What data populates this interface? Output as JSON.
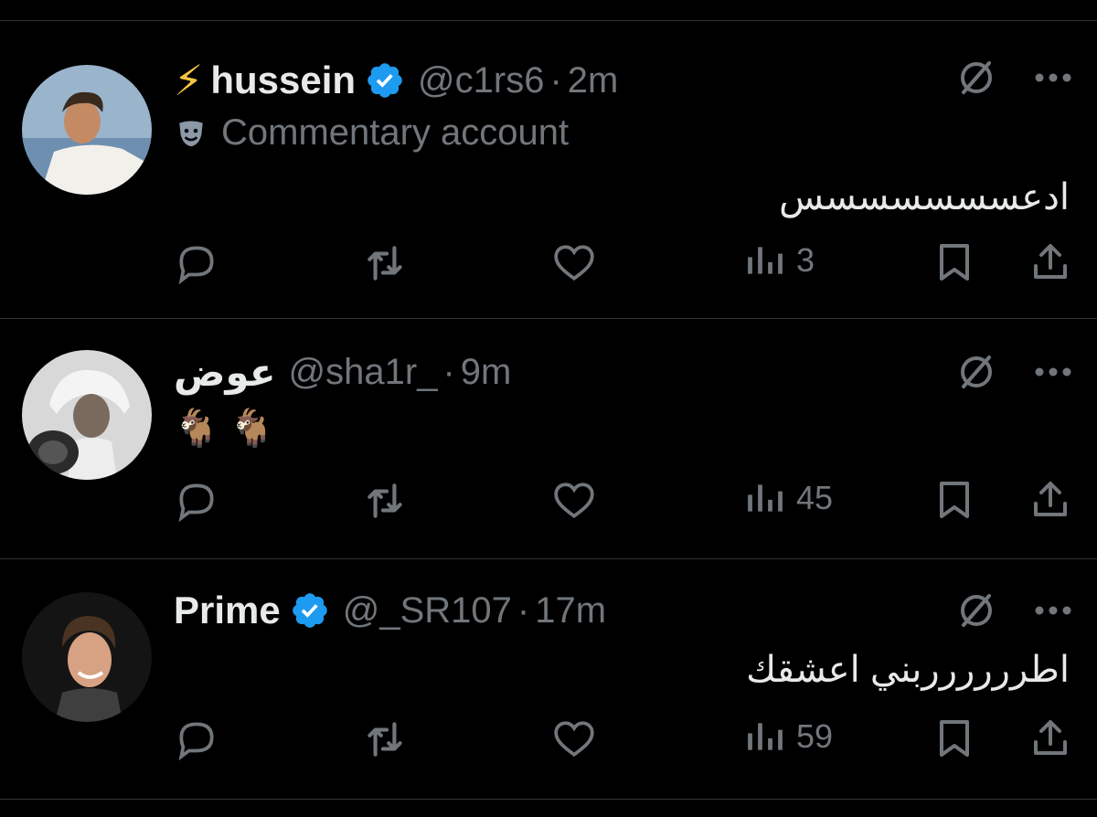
{
  "tweets": [
    {
      "name": "hussein",
      "name_prefix": "⚡",
      "verified": true,
      "handle": "@c1rs6",
      "time": "2m",
      "label": "Commentary account",
      "label_icon": "theater-masks-icon",
      "text": "ادعسسسسسسس",
      "views": "3"
    },
    {
      "name": "عوض",
      "verified": false,
      "handle": "@sha1r_",
      "time": "9m",
      "text": "🐐 🐐",
      "views": "45"
    },
    {
      "name": "Prime",
      "verified": true,
      "handle": "@_SR107",
      "time": "17m",
      "text": "اطرررررربني اعشقك",
      "views": "59"
    }
  ],
  "separator": "·",
  "colors": {
    "background": "#000000",
    "text": "#e7e9ea",
    "muted": "#71767b",
    "verified": "#1d9bf0",
    "divider": "#2f3336"
  }
}
